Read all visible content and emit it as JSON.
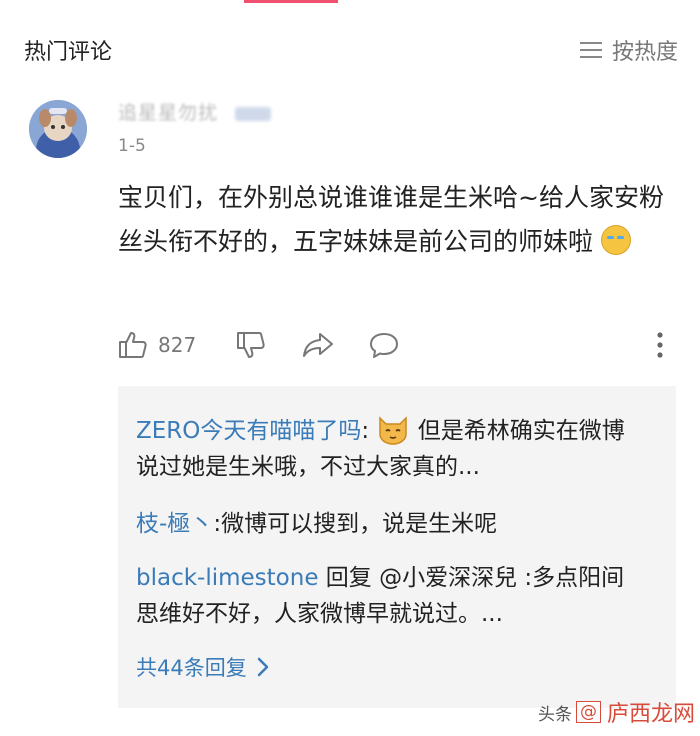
{
  "header": {
    "title": "热门评论",
    "sort_label": "按热度"
  },
  "comment": {
    "username": "追星星勿扰",
    "date": "1-5",
    "text": "宝贝们，在外别总说谁谁谁是生米哈~给人家安粉丝头衔不好的，五字妹妹是前公司的师妹啦",
    "like_count": "827",
    "icons": [
      "thumbs-up-icon",
      "thumbs-down-icon",
      "share-icon",
      "comment-icon",
      "more-icon"
    ]
  },
  "replies": [
    {
      "author": "ZERO今天有喵喵了吗",
      "sep": ":",
      "text": "但是希林确实在微博说过她是生米哦，不过大家真的..."
    },
    {
      "author": "枝-極丶",
      "sep": ":",
      "text": "微博可以搜到，说是生米呢"
    },
    {
      "author": "black-limestone",
      "prefix": " 回复 @小爱深深兒 :",
      "text": "多点阳间思维好不好，人家微博早就说过。..."
    }
  ],
  "more_replies_label": "共44条回复",
  "watermark": {
    "left": "头条",
    "box": "@",
    "brand": "庐西龙网"
  },
  "colors": {
    "link_blue": "#3a7bb8",
    "accent_pink": "#f0506e",
    "reply_bg": "#f4f4f4"
  }
}
